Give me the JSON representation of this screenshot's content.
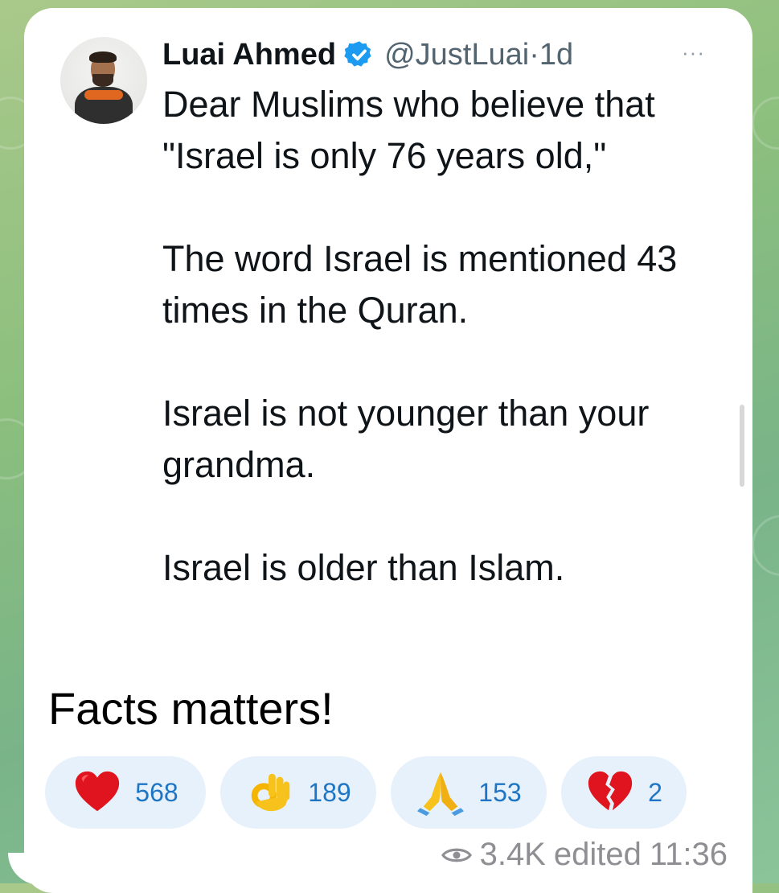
{
  "tweet": {
    "author": "Luai Ahmed",
    "handle": "@JustLuai",
    "separator": "·",
    "time": "1d",
    "more": "···",
    "paragraphs": [
      "Dear Muslims who believe that \"Israel is only 76 years old,\"",
      "The word Israel is mentioned 43 times in the Quran.",
      "Israel is not younger than your grandma.",
      "Israel is older than Islam."
    ]
  },
  "message": {
    "caption": "Facts matters!",
    "reactions": [
      {
        "icon": "red-heart-icon",
        "count": "568"
      },
      {
        "icon": "ok-hand-icon",
        "count": "189"
      },
      {
        "icon": "folded-hands-icon",
        "count": "153"
      },
      {
        "icon": "broken-heart-icon",
        "count": "2"
      }
    ],
    "views": "3.4K",
    "status": "edited",
    "time": "11:36"
  },
  "colors": {
    "reaction_bg": "#e6f1fb",
    "reaction_count": "#1d75c4",
    "verified": "#1d9bf0",
    "chat_background": "#8cbf7e"
  }
}
